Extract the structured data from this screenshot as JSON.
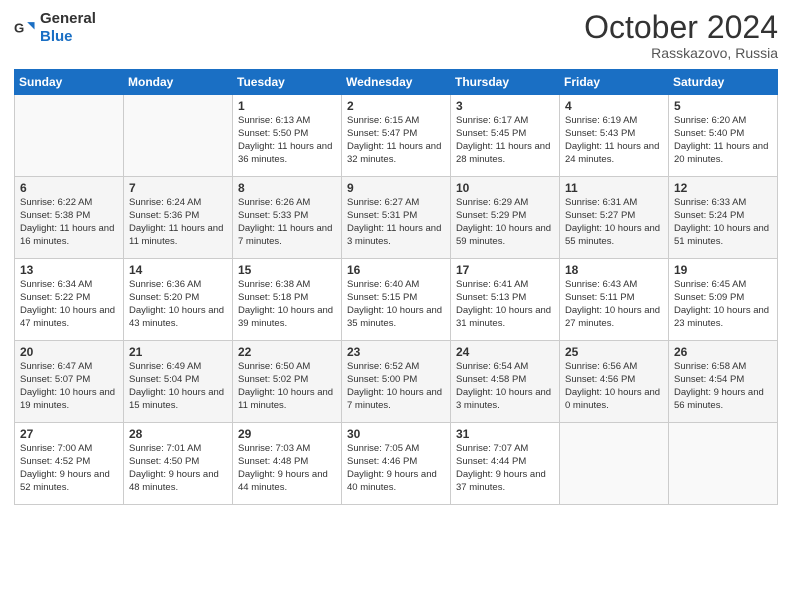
{
  "logo": {
    "general": "General",
    "blue": "Blue"
  },
  "title": "October 2024",
  "location": "Rasskazovo, Russia",
  "days_of_week": [
    "Sunday",
    "Monday",
    "Tuesday",
    "Wednesday",
    "Thursday",
    "Friday",
    "Saturday"
  ],
  "weeks": [
    [
      {
        "day": "",
        "sunrise": "",
        "sunset": "",
        "daylight": ""
      },
      {
        "day": "",
        "sunrise": "",
        "sunset": "",
        "daylight": ""
      },
      {
        "day": "1",
        "sunrise": "Sunrise: 6:13 AM",
        "sunset": "Sunset: 5:50 PM",
        "daylight": "Daylight: 11 hours and 36 minutes."
      },
      {
        "day": "2",
        "sunrise": "Sunrise: 6:15 AM",
        "sunset": "Sunset: 5:47 PM",
        "daylight": "Daylight: 11 hours and 32 minutes."
      },
      {
        "day": "3",
        "sunrise": "Sunrise: 6:17 AM",
        "sunset": "Sunset: 5:45 PM",
        "daylight": "Daylight: 11 hours and 28 minutes."
      },
      {
        "day": "4",
        "sunrise": "Sunrise: 6:19 AM",
        "sunset": "Sunset: 5:43 PM",
        "daylight": "Daylight: 11 hours and 24 minutes."
      },
      {
        "day": "5",
        "sunrise": "Sunrise: 6:20 AM",
        "sunset": "Sunset: 5:40 PM",
        "daylight": "Daylight: 11 hours and 20 minutes."
      }
    ],
    [
      {
        "day": "6",
        "sunrise": "Sunrise: 6:22 AM",
        "sunset": "Sunset: 5:38 PM",
        "daylight": "Daylight: 11 hours and 16 minutes."
      },
      {
        "day": "7",
        "sunrise": "Sunrise: 6:24 AM",
        "sunset": "Sunset: 5:36 PM",
        "daylight": "Daylight: 11 hours and 11 minutes."
      },
      {
        "day": "8",
        "sunrise": "Sunrise: 6:26 AM",
        "sunset": "Sunset: 5:33 PM",
        "daylight": "Daylight: 11 hours and 7 minutes."
      },
      {
        "day": "9",
        "sunrise": "Sunrise: 6:27 AM",
        "sunset": "Sunset: 5:31 PM",
        "daylight": "Daylight: 11 hours and 3 minutes."
      },
      {
        "day": "10",
        "sunrise": "Sunrise: 6:29 AM",
        "sunset": "Sunset: 5:29 PM",
        "daylight": "Daylight: 10 hours and 59 minutes."
      },
      {
        "day": "11",
        "sunrise": "Sunrise: 6:31 AM",
        "sunset": "Sunset: 5:27 PM",
        "daylight": "Daylight: 10 hours and 55 minutes."
      },
      {
        "day": "12",
        "sunrise": "Sunrise: 6:33 AM",
        "sunset": "Sunset: 5:24 PM",
        "daylight": "Daylight: 10 hours and 51 minutes."
      }
    ],
    [
      {
        "day": "13",
        "sunrise": "Sunrise: 6:34 AM",
        "sunset": "Sunset: 5:22 PM",
        "daylight": "Daylight: 10 hours and 47 minutes."
      },
      {
        "day": "14",
        "sunrise": "Sunrise: 6:36 AM",
        "sunset": "Sunset: 5:20 PM",
        "daylight": "Daylight: 10 hours and 43 minutes."
      },
      {
        "day": "15",
        "sunrise": "Sunrise: 6:38 AM",
        "sunset": "Sunset: 5:18 PM",
        "daylight": "Daylight: 10 hours and 39 minutes."
      },
      {
        "day": "16",
        "sunrise": "Sunrise: 6:40 AM",
        "sunset": "Sunset: 5:15 PM",
        "daylight": "Daylight: 10 hours and 35 minutes."
      },
      {
        "day": "17",
        "sunrise": "Sunrise: 6:41 AM",
        "sunset": "Sunset: 5:13 PM",
        "daylight": "Daylight: 10 hours and 31 minutes."
      },
      {
        "day": "18",
        "sunrise": "Sunrise: 6:43 AM",
        "sunset": "Sunset: 5:11 PM",
        "daylight": "Daylight: 10 hours and 27 minutes."
      },
      {
        "day": "19",
        "sunrise": "Sunrise: 6:45 AM",
        "sunset": "Sunset: 5:09 PM",
        "daylight": "Daylight: 10 hours and 23 minutes."
      }
    ],
    [
      {
        "day": "20",
        "sunrise": "Sunrise: 6:47 AM",
        "sunset": "Sunset: 5:07 PM",
        "daylight": "Daylight: 10 hours and 19 minutes."
      },
      {
        "day": "21",
        "sunrise": "Sunrise: 6:49 AM",
        "sunset": "Sunset: 5:04 PM",
        "daylight": "Daylight: 10 hours and 15 minutes."
      },
      {
        "day": "22",
        "sunrise": "Sunrise: 6:50 AM",
        "sunset": "Sunset: 5:02 PM",
        "daylight": "Daylight: 10 hours and 11 minutes."
      },
      {
        "day": "23",
        "sunrise": "Sunrise: 6:52 AM",
        "sunset": "Sunset: 5:00 PM",
        "daylight": "Daylight: 10 hours and 7 minutes."
      },
      {
        "day": "24",
        "sunrise": "Sunrise: 6:54 AM",
        "sunset": "Sunset: 4:58 PM",
        "daylight": "Daylight: 10 hours and 3 minutes."
      },
      {
        "day": "25",
        "sunrise": "Sunrise: 6:56 AM",
        "sunset": "Sunset: 4:56 PM",
        "daylight": "Daylight: 10 hours and 0 minutes."
      },
      {
        "day": "26",
        "sunrise": "Sunrise: 6:58 AM",
        "sunset": "Sunset: 4:54 PM",
        "daylight": "Daylight: 9 hours and 56 minutes."
      }
    ],
    [
      {
        "day": "27",
        "sunrise": "Sunrise: 7:00 AM",
        "sunset": "Sunset: 4:52 PM",
        "daylight": "Daylight: 9 hours and 52 minutes."
      },
      {
        "day": "28",
        "sunrise": "Sunrise: 7:01 AM",
        "sunset": "Sunset: 4:50 PM",
        "daylight": "Daylight: 9 hours and 48 minutes."
      },
      {
        "day": "29",
        "sunrise": "Sunrise: 7:03 AM",
        "sunset": "Sunset: 4:48 PM",
        "daylight": "Daylight: 9 hours and 44 minutes."
      },
      {
        "day": "30",
        "sunrise": "Sunrise: 7:05 AM",
        "sunset": "Sunset: 4:46 PM",
        "daylight": "Daylight: 9 hours and 40 minutes."
      },
      {
        "day": "31",
        "sunrise": "Sunrise: 7:07 AM",
        "sunset": "Sunset: 4:44 PM",
        "daylight": "Daylight: 9 hours and 37 minutes."
      },
      {
        "day": "",
        "sunrise": "",
        "sunset": "",
        "daylight": ""
      },
      {
        "day": "",
        "sunrise": "",
        "sunset": "",
        "daylight": ""
      }
    ]
  ]
}
